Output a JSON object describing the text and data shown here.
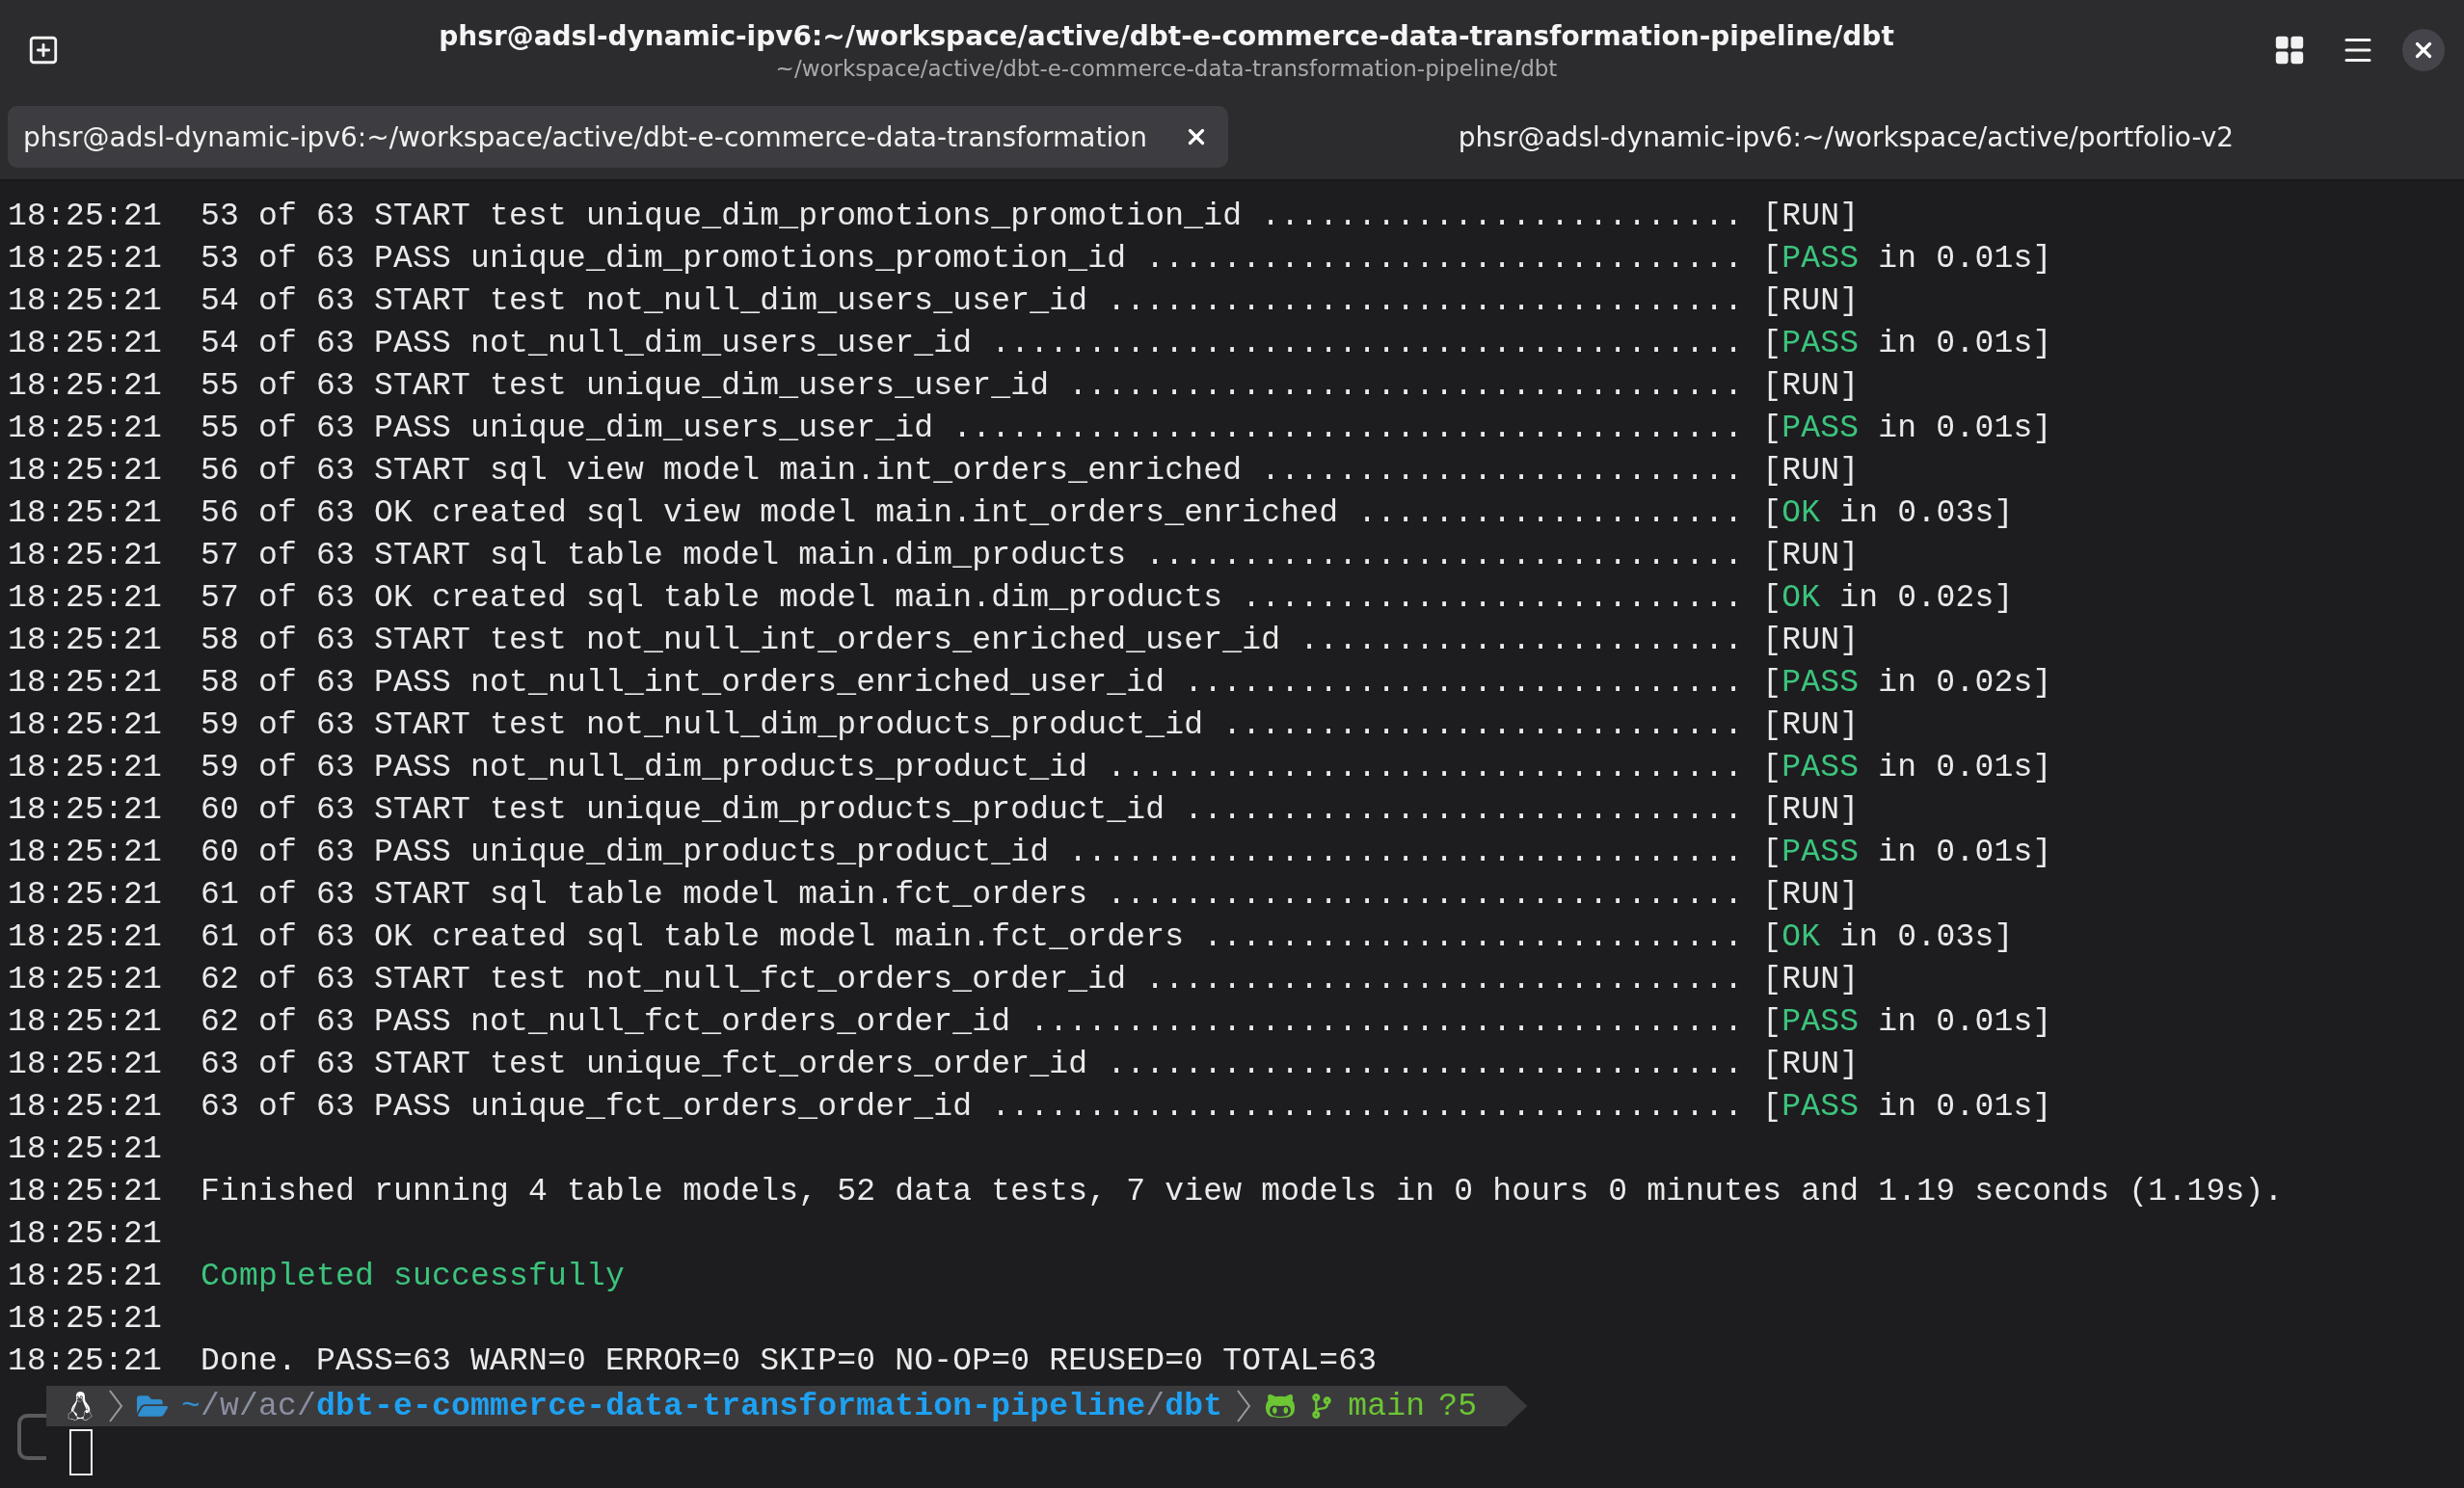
{
  "window": {
    "title": "phsr@adsl-dynamic-ipv6:~/workspace/active/dbt-e-commerce-data-transformation-pipeline/dbt",
    "subtitle": "~/workspace/active/dbt-e-commerce-data-transformation-pipeline/dbt"
  },
  "tabs": [
    {
      "label": "phsr@adsl-dynamic-ipv6:~/workspace/active/dbt-e-commerce-data-transformation",
      "selected": true
    },
    {
      "label": "phsr@adsl-dynamic-ipv6:~/workspace/active/portfolio-v2",
      "selected": false
    }
  ],
  "lines": [
    {
      "time": "18:25:21",
      "text": "53 of 63 START test unique_dim_promotions_promotion_id .........................",
      "kind": "run",
      "result": {
        "open": "[",
        "word": "RUN",
        "close": "]"
      }
    },
    {
      "time": "18:25:21",
      "text": "53 of 63 PASS unique_dim_promotions_promotion_id ...............................",
      "kind": "pass",
      "result": {
        "open": "[",
        "word": "PASS",
        "close": " in 0.01s]"
      }
    },
    {
      "time": "18:25:21",
      "text": "54 of 63 START test not_null_dim_users_user_id .................................",
      "kind": "run",
      "result": {
        "open": "[",
        "word": "RUN",
        "close": "]"
      }
    },
    {
      "time": "18:25:21",
      "text": "54 of 63 PASS not_null_dim_users_user_id .......................................",
      "kind": "pass",
      "result": {
        "open": "[",
        "word": "PASS",
        "close": " in 0.01s]"
      }
    },
    {
      "time": "18:25:21",
      "text": "55 of 63 START test unique_dim_users_user_id ...................................",
      "kind": "run",
      "result": {
        "open": "[",
        "word": "RUN",
        "close": "]"
      }
    },
    {
      "time": "18:25:21",
      "text": "55 of 63 PASS unique_dim_users_user_id .........................................",
      "kind": "pass",
      "result": {
        "open": "[",
        "word": "PASS",
        "close": " in 0.01s]"
      }
    },
    {
      "time": "18:25:21",
      "text": "56 of 63 START sql view model main.int_orders_enriched .........................",
      "kind": "run",
      "result": {
        "open": "[",
        "word": "RUN",
        "close": "]"
      }
    },
    {
      "time": "18:25:21",
      "text": "56 of 63 OK created sql view model main.int_orders_enriched ....................",
      "kind": "pass",
      "result": {
        "open": "[",
        "word": "OK",
        "close": " in 0.03s]"
      }
    },
    {
      "time": "18:25:21",
      "text": "57 of 63 START sql table model main.dim_products ...............................",
      "kind": "run",
      "result": {
        "open": "[",
        "word": "RUN",
        "close": "]"
      }
    },
    {
      "time": "18:25:21",
      "text": "57 of 63 OK created sql table model main.dim_products ..........................",
      "kind": "pass",
      "result": {
        "open": "[",
        "word": "OK",
        "close": " in 0.02s]"
      }
    },
    {
      "time": "18:25:21",
      "text": "58 of 63 START test not_null_int_orders_enriched_user_id .......................",
      "kind": "run",
      "result": {
        "open": "[",
        "word": "RUN",
        "close": "]"
      }
    },
    {
      "time": "18:25:21",
      "text": "58 of 63 PASS not_null_int_orders_enriched_user_id .............................",
      "kind": "pass",
      "result": {
        "open": "[",
        "word": "PASS",
        "close": " in 0.02s]"
      }
    },
    {
      "time": "18:25:21",
      "text": "59 of 63 START test not_null_dim_products_product_id ...........................",
      "kind": "run",
      "result": {
        "open": "[",
        "word": "RUN",
        "close": "]"
      }
    },
    {
      "time": "18:25:21",
      "text": "59 of 63 PASS not_null_dim_products_product_id .................................",
      "kind": "pass",
      "result": {
        "open": "[",
        "word": "PASS",
        "close": " in 0.01s]"
      }
    },
    {
      "time": "18:25:21",
      "text": "60 of 63 START test unique_dim_products_product_id .............................",
      "kind": "run",
      "result": {
        "open": "[",
        "word": "RUN",
        "close": "]"
      }
    },
    {
      "time": "18:25:21",
      "text": "60 of 63 PASS unique_dim_products_product_id ...................................",
      "kind": "pass",
      "result": {
        "open": "[",
        "word": "PASS",
        "close": " in 0.01s]"
      }
    },
    {
      "time": "18:25:21",
      "text": "61 of 63 START sql table model main.fct_orders .................................",
      "kind": "run",
      "result": {
        "open": "[",
        "word": "RUN",
        "close": "]"
      }
    },
    {
      "time": "18:25:21",
      "text": "61 of 63 OK created sql table model main.fct_orders ............................",
      "kind": "pass",
      "result": {
        "open": "[",
        "word": "OK",
        "close": " in 0.03s]"
      }
    },
    {
      "time": "18:25:21",
      "text": "62 of 63 START test not_null_fct_orders_order_id ...............................",
      "kind": "run",
      "result": {
        "open": "[",
        "word": "RUN",
        "close": "]"
      }
    },
    {
      "time": "18:25:21",
      "text": "62 of 63 PASS not_null_fct_orders_order_id .....................................",
      "kind": "pass",
      "result": {
        "open": "[",
        "word": "PASS",
        "close": " in 0.01s]"
      }
    },
    {
      "time": "18:25:21",
      "text": "63 of 63 START test unique_fct_orders_order_id .................................",
      "kind": "run",
      "result": {
        "open": "[",
        "word": "RUN",
        "close": "]"
      }
    },
    {
      "time": "18:25:21",
      "text": "63 of 63 PASS unique_fct_orders_order_id .......................................",
      "kind": "pass",
      "result": {
        "open": "[",
        "word": "PASS",
        "close": " in 0.01s]"
      }
    },
    {
      "time": "18:25:21",
      "kind": "blank"
    },
    {
      "time": "18:25:21",
      "text": "Finished running 4 table models, 52 data tests, 7 view models in 0 hours 0 minutes and 1.19 seconds (1.19s).",
      "kind": "plain"
    },
    {
      "time": "18:25:21",
      "kind": "blank"
    },
    {
      "time": "18:25:21",
      "text": "Completed successfully",
      "kind": "success"
    },
    {
      "time": "18:25:21",
      "kind": "blank"
    },
    {
      "time": "18:25:21",
      "text": "Done. PASS=63 WARN=0 ERROR=0 SKIP=0 NO-OP=0 REUSED=0 TOTAL=63",
      "kind": "plain"
    }
  ],
  "prompt": {
    "path": [
      {
        "text": "~",
        "color": "#2f8fd0",
        "bold": false
      },
      {
        "text": "/",
        "color": "#8a8fa0",
        "bold": false
      },
      {
        "text": "w",
        "color": "#8a8fa0",
        "bold": false
      },
      {
        "text": "/",
        "color": "#8a8fa0",
        "bold": false
      },
      {
        "text": "ac",
        "color": "#8a8fa0",
        "bold": false
      },
      {
        "text": "/",
        "color": "#8a8fa0",
        "bold": false
      },
      {
        "text": "dbt-e-commerce-data-transformation-pipeline",
        "color": "#1ea1f2",
        "bold": true
      },
      {
        "text": "/",
        "color": "#8a8fa0",
        "bold": false
      },
      {
        "text": "dbt",
        "color": "#1ea1f2",
        "bold": true
      }
    ],
    "branch": "main",
    "status": "?5"
  }
}
